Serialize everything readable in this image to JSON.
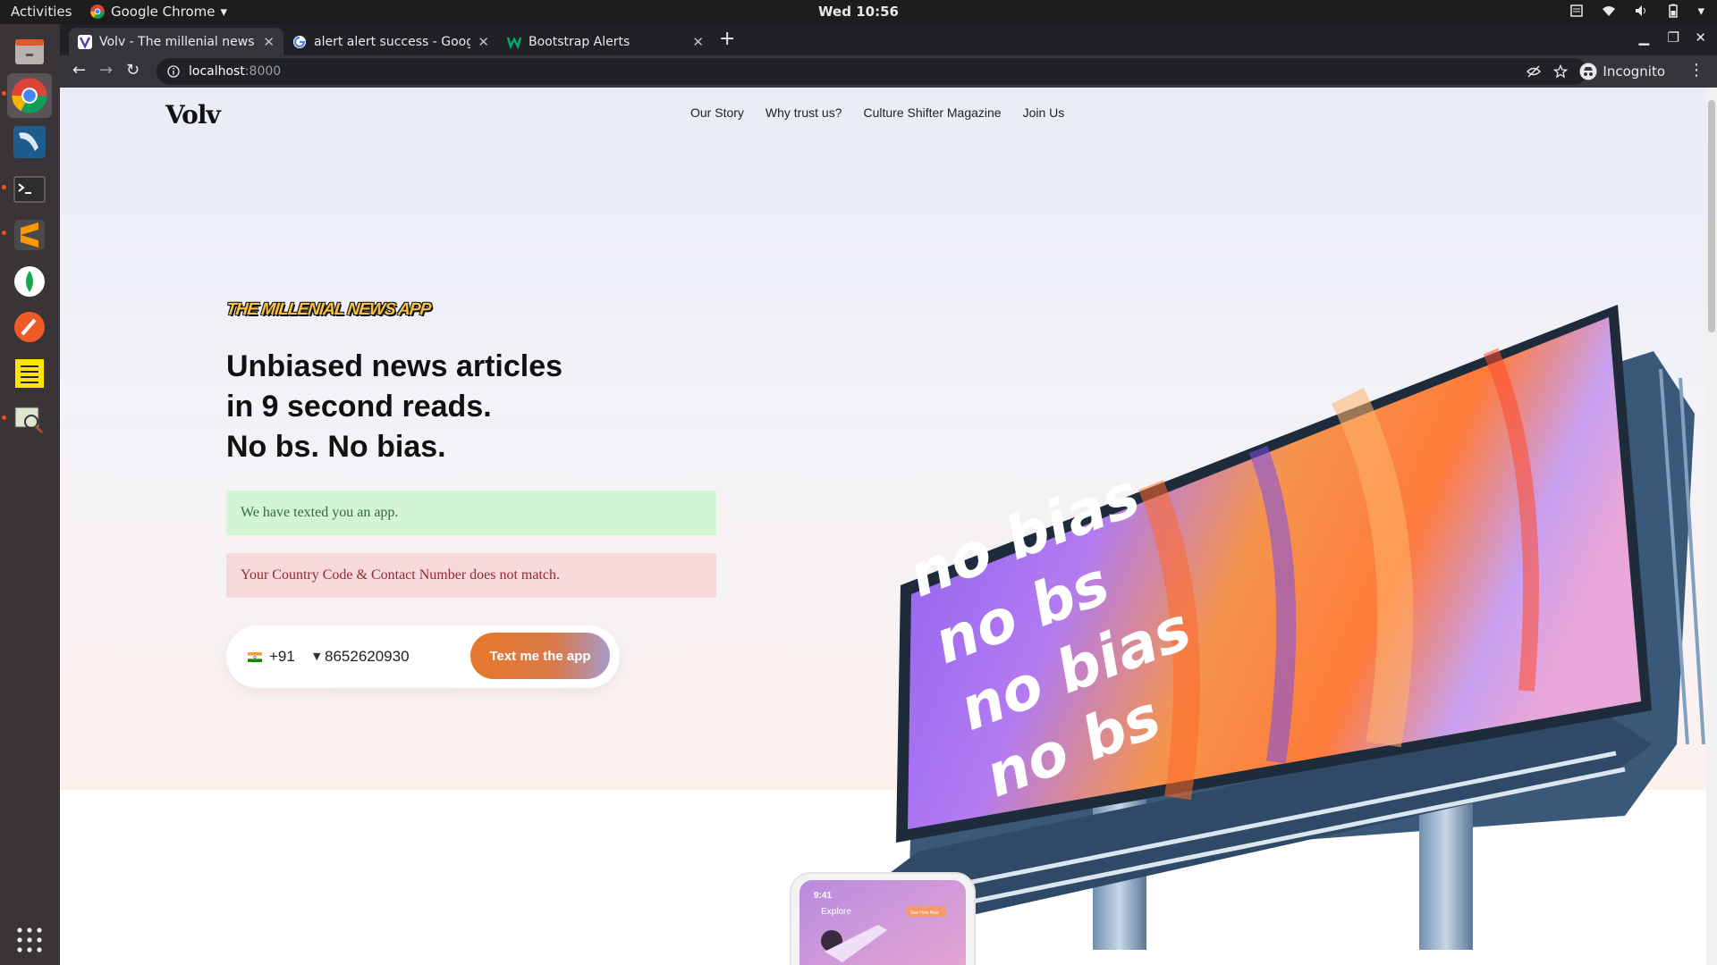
{
  "os": {
    "activities": "Activities",
    "app_menu": "Google Chrome",
    "clock": "Wed 10:56"
  },
  "browser": {
    "tabs": [
      {
        "title": "Volv - The millenial news a"
      },
      {
        "title": "alert alert success - Googl"
      },
      {
        "title": "Bootstrap Alerts"
      }
    ],
    "url_host": "localhost",
    "url_port": ":8000",
    "profile": "Incognito"
  },
  "page": {
    "logo": "Volv",
    "nav": [
      "Our Story",
      "Why trust us?",
      "Culture Shifter Magazine",
      "Join Us"
    ],
    "tagline": "THE MILLENIAL NEWS APP",
    "headline": [
      "Unbiased news articles",
      "in 9 second reads.",
      "No bs. No bias."
    ],
    "alert_success": "We have texted you an app.",
    "alert_danger": "Your Country Code & Contact Number does not match.",
    "country_code": "+91",
    "phone_value": "8652620930",
    "cta_label": "Text me the app",
    "billboard_text": [
      "no bias",
      "no bs",
      "no bias",
      "no bs"
    ],
    "phone_mock": {
      "time": "9:41",
      "title": "Explore",
      "badge": "See How Now"
    }
  },
  "colors": {
    "accent_orange": "#e7782b",
    "success_bg": "#d4f4d6",
    "danger_bg": "#f7d9dc",
    "tagline_yellow": "#f7c244"
  }
}
